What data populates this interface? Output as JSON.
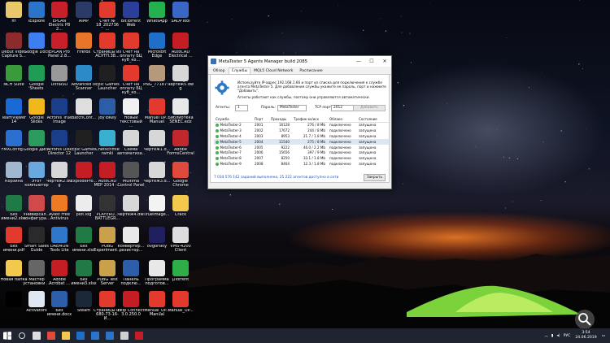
{
  "desktop": {
    "icons": [
      {
        "label": "fff",
        "color": "#e8c86a"
      },
      {
        "label": "iExplore",
        "color": "#2a74c9"
      },
      {
        "label": "EPLAN Electric P8 2...",
        "color": "#c8202a"
      },
      {
        "label": "AIMP",
        "color": "#2b3a67"
      },
      {
        "label": "Счет № 18_202736 ...",
        "color": "#e33a2e"
      },
      {
        "label": "BitTorrent Web",
        "color": "#2b3f9a"
      },
      {
        "label": "WhatsApp",
        "color": "#23b14d"
      },
      {
        "label": "SADPTool",
        "color": "#3a66c5"
      },
      {
        "label": "Debut Video Capture S...",
        "color": "#8b2b2b"
      },
      {
        "label": "Google Docs",
        "color": "#3d7ff0"
      },
      {
        "label": "EPLAN Pro Panel 2.8...",
        "color": "#c8202a"
      },
      {
        "label": "Firefox",
        "color": "#e8762a"
      },
      {
        "label": "Страницы из АСУТП.38...",
        "color": "#e33a2e"
      },
      {
        "label": "Счет на оплату БЦ куб_ко...",
        "color": "#e33a2e"
      },
      {
        "label": "Microsoft Edge",
        "color": "#1f6fc8"
      },
      {
        "label": "AutoCAD Electrical ...",
        "color": "#c41d24"
      },
      {
        "label": "NCH Suite",
        "color": "#3a9b3a"
      },
      {
        "label": "Google Sheets",
        "color": "#1f9d55"
      },
      {
        "label": "UltraISO",
        "color": "#999999"
      },
      {
        "label": "Advanced IP Scanner",
        "color": "#2d8ac9"
      },
      {
        "label": "Epic Games Launcher",
        "color": "#202020"
      },
      {
        "label": "Счет на оплату БЦ куб_ко...",
        "color": "#e33a2e"
      },
      {
        "label": "PNG_77187...",
        "color": "#b49a7a"
      },
      {
        "label": "Чертеж5.dwg",
        "color": "#d7d7d7"
      },
      {
        "label": "TeamViewer 14",
        "color": "#1a6ad5"
      },
      {
        "label": "Google Slides",
        "color": "#f2b81b"
      },
      {
        "label": "Acronis True Image",
        "color": "#1b3e8a"
      },
      {
        "label": "BatchConf...",
        "color": "#dedede"
      },
      {
        "label": "JoyToKey",
        "color": "#2c5ea8"
      },
      {
        "label": "Новый текстовый ...",
        "color": "#f0f0f0"
      },
      {
        "label": "Manuel UP... Manuel",
        "color": "#e33a2e"
      },
      {
        "label": "Библиотека SENEC.edz",
        "color": "#e8e8e8"
      },
      {
        "label": "FMXConfig...",
        "color": "#2d6fd0"
      },
      {
        "label": "Google Диск",
        "color": "#2b9b5e"
      },
      {
        "label": "Acronis Disk Director 12",
        "color": "#1b3e8a"
      },
      {
        "label": "Epic Games Launcher",
        "color": "#202020"
      },
      {
        "label": "Chetschmie ramki",
        "color": "#3ab0d0"
      },
      {
        "label": "Схема автоматиза...",
        "color": "#d6d6d6"
      },
      {
        "label": "Чертеж1.d...",
        "color": "#d7d7d7"
      },
      {
        "label": "Adobe FormsCentral",
        "color": "#c0282d"
      },
      {
        "label": "Корзина",
        "color": "#9fb7cf"
      },
      {
        "label": "Этот компьютер",
        "color": "#6aa8e0"
      },
      {
        "label": "Чертеж2.dwg",
        "color": "#d7d7d7"
      },
      {
        "label": "ExplodePro...",
        "color": "#c41d24"
      },
      {
        "label": "AutoCAD MEP 2014 -...",
        "color": "#c41d24"
      },
      {
        "label": "Multima Control Panel",
        "color": "#555555"
      },
      {
        "label": "Чертеж3.d...",
        "color": "#d7d7d7"
      },
      {
        "label": "Google Chrome",
        "color": "#e04a3c"
      },
      {
        "label": "Без имени2.xlsx",
        "color": "#1f7a45"
      },
      {
        "label": "Универсал... конфигура...",
        "color": "#d04a4a"
      },
      {
        "label": "Avast Free Antivirus",
        "color": "#f07a22"
      },
      {
        "label": "plot.log",
        "color": "#ececec"
      },
      {
        "label": "PLAYERU... BATTLEGR...",
        "color": "#333333"
      },
      {
        "label": "Чертеж4.dwl",
        "color": "#d7d7d7"
      },
      {
        "label": "TrueImage...",
        "color": "#f3f3f3"
      },
      {
        "label": "Crack",
        "color": "#f2c94c"
      },
      {
        "label": "Без имени.pdf",
        "color": "#e33a2e"
      },
      {
        "label": "Smart Sales Guide",
        "color": "#2a2a2a"
      },
      {
        "label": "DAEMON Tools Lite",
        "color": "#2f77c8"
      },
      {
        "label": "Без имени.xlsx",
        "color": "#1f7a45"
      },
      {
        "label": "PUBG Experiment...",
        "color": "#c9a14a"
      },
      {
        "label": "конвертир... резистор...",
        "color": "#e8e8e8"
      },
      {
        "label": "ovgorskiy",
        "color": "#202060"
      },
      {
        "label": "VMS-4200 Client",
        "color": "#dddddd"
      },
      {
        "label": "Новая папка",
        "color": "#f2c94c"
      },
      {
        "label": "Мастер установки ...",
        "color": "#666666"
      },
      {
        "label": "Adobe Acrobat ...",
        "color": "#c41d24"
      },
      {
        "label": "Без имени3.xlsx",
        "color": "#1f7a45"
      },
      {
        "label": "PUBG Test Server",
        "color": "#c9a14a"
      },
      {
        "label": "Панель подклю...",
        "color": "#2b5da8"
      },
      {
        "label": "Программа подготов...",
        "color": "#e8e8e8"
      },
      {
        "label": "µTorrent",
        "color": "#2fae48"
      },
      {
        "label": "",
        "color": "#000000"
      },
      {
        "label": "Activators",
        "color": "#dfe7f0"
      },
      {
        "label": "Без имени.docx",
        "color": "#2b5da8"
      },
      {
        "label": "Steam",
        "color": "#1b2838"
      },
      {
        "label": "Страницы из 680-73-16-И...",
        "color": "#e33a2e"
      },
      {
        "label": "Ekip Connect 3.0.250.0",
        "color": "#c41d24"
      },
      {
        "label": "Manual_UP... Manual",
        "color": "#e33a2e"
      },
      {
        "label": "Manual_UP...",
        "color": "#e33a2e"
      },
      {
        "label": "СГЦДС GraphicCS ...",
        "color": "#e8e8e8"
      }
    ]
  },
  "window": {
    "title": "MetaTester 5 Agents Manager build 2085",
    "tabs": [
      "Обзор",
      "Службы",
      "MQL5 Cloud Network",
      "Расписание"
    ],
    "active_tab": 1,
    "description": "Используйте IP-адрес 192.168.1.66 и порт из списка для подключения к службе агента MetaTester 5. Для добавления службы укажите ее пароль, порт и нажмите \"Добавить\".",
    "description2": "Агенты работают как службы, поэтому они управляются автоматически.",
    "agents_label": "Агенты:",
    "agents_value": "1",
    "password_label": "Пароль:",
    "password_value": "MetaTester",
    "tcp_label": "TCP порт:",
    "tcp_value": "2012",
    "add_button": "Добавить",
    "columns": [
      "Служба",
      "Порт",
      "Проходы",
      "Трафик вх/исх",
      "Облако",
      "Состояние"
    ],
    "rows": [
      [
        "MetaTester-2",
        "2001",
        "16128",
        "276 / 8 Mb",
        "подключено",
        "запущена"
      ],
      [
        "MetaTester-3",
        "2002",
        "17672",
        "244 / 8 Mb",
        "подключено",
        "запущена"
      ],
      [
        "MetaTester-4",
        "2003",
        "8953",
        "21.7 / 1.8 Mb",
        "подключено",
        "запущена"
      ],
      [
        "MetaTester-5",
        "2004",
        "11540",
        "275 / 8 Mb",
        "подключено",
        "запущена"
      ],
      [
        "MetaTester-6",
        "2005",
        "9222",
        "46.0 / 2.2 Mb",
        "подключено",
        "запущена"
      ],
      [
        "MetaTester-7",
        "2006",
        "15656",
        "397 / 9 Mb",
        "подключено",
        "запущена"
      ],
      [
        "MetaTester-8",
        "2007",
        "8250",
        "33.1 / 1.8 Mb",
        "подключено",
        "запущена"
      ],
      [
        "MetaTester-9",
        "2008",
        "8464",
        "12.3 / 1.8 Mb",
        "подключено",
        "запущена"
      ]
    ],
    "selected_row": 3,
    "status_text": "7 034 576 142 заданий выполнено, 25 222 агентов доступно в сети",
    "close_button": "Закрыть"
  },
  "taskbar": {
    "apps": [
      {
        "name": "start",
        "color": "#ffffff"
      },
      {
        "name": "search",
        "color": "#dddddd"
      },
      {
        "name": "task-view",
        "color": "#dddddd"
      },
      {
        "name": "chrome",
        "color": "#e04a3c"
      },
      {
        "name": "explorer",
        "color": "#f2c94c"
      },
      {
        "name": "edge",
        "color": "#1f6fc8"
      },
      {
        "name": "store",
        "color": "#2a74c9"
      },
      {
        "name": "mail",
        "color": "#2a74c9"
      },
      {
        "name": "metatester",
        "color": "#cfcfcf"
      },
      {
        "name": "acrobat",
        "color": "#c41d24"
      }
    ],
    "lang": "РУС",
    "time": "3:54",
    "date": "24.06.2019"
  }
}
